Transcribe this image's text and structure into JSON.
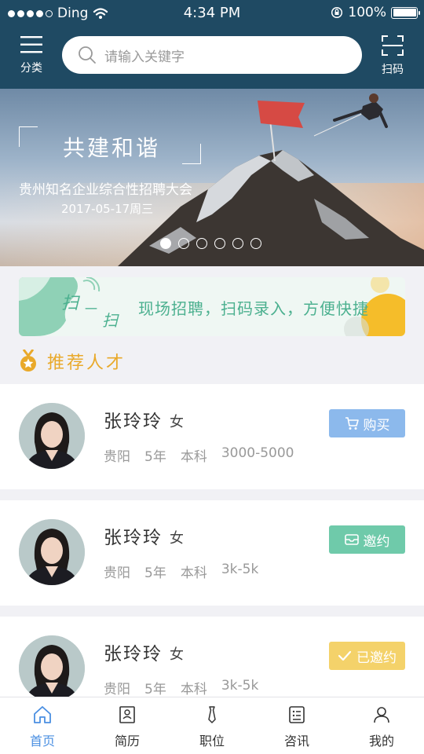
{
  "status_bar": {
    "carrier": "Ding",
    "time": "4:34 PM",
    "battery": "100%"
  },
  "nav": {
    "category_label": "分类",
    "scan_label": "扫码",
    "search_placeholder": "请输入关键字"
  },
  "banner": {
    "title": "共建和谐",
    "subtitle": "贵州知名企业综合性招聘大会",
    "date": "2017-05-17周三",
    "page_count": 6,
    "active_page": 1
  },
  "promo": {
    "text": "现场招聘，扫码录入，方便快捷"
  },
  "section": {
    "title": "推荐人才"
  },
  "candidates": [
    {
      "name": "张玲玲",
      "gender": "女",
      "city": "贵阳",
      "experience": "5年",
      "education": "本科",
      "salary": "3000-5000",
      "action": "购买",
      "action_icon": "cart-icon"
    },
    {
      "name": "张玲玲",
      "gender": "女",
      "city": "贵阳",
      "experience": "5年",
      "education": "本科",
      "salary": "3k-5k",
      "action": "邀约",
      "action_icon": "mail-icon"
    },
    {
      "name": "张玲玲",
      "gender": "女",
      "city": "贵阳",
      "experience": "5年",
      "education": "本科",
      "salary": "3k-5k",
      "action": "已邀约",
      "action_icon": "check-icon"
    }
  ],
  "tabs": [
    {
      "label": "首页",
      "icon": "home-icon",
      "active": true
    },
    {
      "label": "简历",
      "icon": "resume-icon",
      "active": false
    },
    {
      "label": "职位",
      "icon": "tie-icon",
      "active": false
    },
    {
      "label": "咨讯",
      "icon": "news-icon",
      "active": false
    },
    {
      "label": "我的",
      "icon": "user-icon",
      "active": false
    }
  ],
  "colors": {
    "header_bg": "#1f4a63",
    "accent_orange": "#e9a92a",
    "buy_button": "#8cb9ec",
    "invite_button": "#6fcaaa",
    "invited_button": "#f4d26a",
    "tab_active": "#4a8fe2"
  }
}
